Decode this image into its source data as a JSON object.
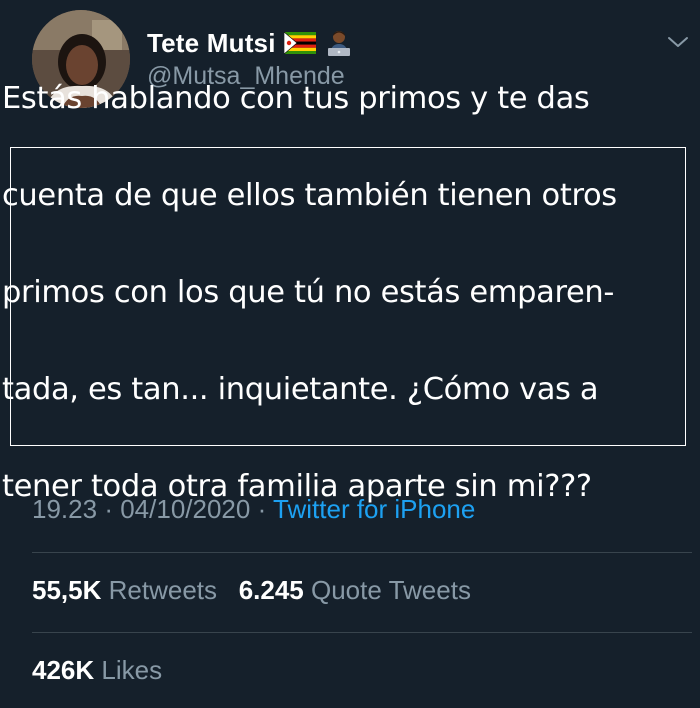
{
  "author": {
    "display_name": "Tete Mutsi",
    "handle": "@Mutsa_Mhende",
    "icons": [
      "zimbabwe-flag-icon",
      "technologist-emoji-icon"
    ]
  },
  "tweet": {
    "text_lines": [
      "Estás hablando con tus primos y te das",
      "cuenta de que ellos también tienen otros",
      "primos con los que tú no estás emparen-",
      "tada, es tan... inquietante. ¿Cómo vas a",
      "tener toda otra familia aparte sin mi???"
    ]
  },
  "meta": {
    "time": "19.23",
    "separator": "·",
    "date": "04/10/2020",
    "source": "Twitter for iPhone"
  },
  "stats": {
    "retweets_count": "55,5K",
    "retweets_label": "Retweets",
    "quotes_count": "6.245",
    "quotes_label": "Quote Tweets",
    "likes_count": "426K",
    "likes_label": "Likes"
  },
  "colors": {
    "background": "#15202b",
    "secondary_text": "#8899a6",
    "link": "#1da1f2",
    "divider": "#38444d"
  }
}
